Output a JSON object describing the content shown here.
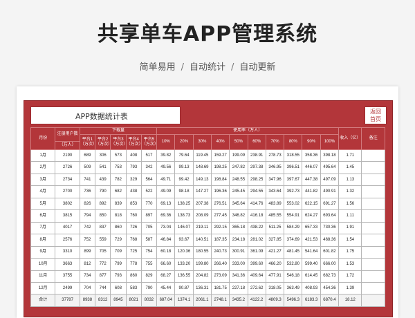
{
  "title": "共享单车APP管理系统",
  "subtitle": [
    "简单易用",
    "自动统计",
    "自动更新"
  ],
  "separator": "/",
  "panel": {
    "heading": "APP数据统计表",
    "return_label": [
      "返回",
      "首页"
    ]
  },
  "table": {
    "headers": {
      "month": "月份",
      "users": "注册用户数",
      "users_unit": "（万人）",
      "downloads": "下载量",
      "platforms": [
        "平台1（万次）",
        "平台2（万次）",
        "平台3（万次）",
        "平台4（万次）",
        "平台5（万次）"
      ],
      "usage": "使用率（万人）",
      "usage_levels": [
        "10%",
        "20%",
        "30%",
        "40%",
        "50%",
        "60%",
        "70%",
        "80%",
        "90%",
        "100%"
      ],
      "income": "收入（亿）",
      "note": "备注"
    },
    "rows": [
      [
        "1月",
        "2190",
        "689",
        "306",
        "573",
        "408",
        "517",
        "39.82",
        "79.64",
        "119.45",
        "159.27",
        "199.09",
        "238.91",
        "278.73",
        "318.55",
        "358.36",
        "398.18",
        "1.71",
        ""
      ],
      [
        "2月",
        "2726",
        "509",
        "541",
        "753",
        "793",
        "342",
        "49.56",
        "99.13",
        "148.69",
        "198.25",
        "247.82",
        "297.38",
        "346.95",
        "396.51",
        "446.07",
        "495.64",
        "1.45",
        ""
      ],
      [
        "3月",
        "2734",
        "741",
        "439",
        "782",
        "329",
        "564",
        "49.71",
        "99.42",
        "149.13",
        "198.84",
        "248.55",
        "298.25",
        "347.96",
        "397.67",
        "447.38",
        "497.09",
        "1.13",
        ""
      ],
      [
        "4月",
        "2700",
        "736",
        "790",
        "682",
        "438",
        "522",
        "49.09",
        "98.18",
        "147.27",
        "196.36",
        "245.45",
        "294.55",
        "343.64",
        "392.73",
        "441.82",
        "490.91",
        "1.32",
        ""
      ],
      [
        "5月",
        "3802",
        "826",
        "892",
        "839",
        "853",
        "770",
        "69.13",
        "138.25",
        "207.38",
        "276.51",
        "345.64",
        "414.76",
        "483.89",
        "553.02",
        "622.15",
        "691.27",
        "1.56",
        ""
      ],
      [
        "6月",
        "3815",
        "794",
        "850",
        "818",
        "760",
        "897",
        "69.36",
        "138.73",
        "208.09",
        "277.45",
        "346.82",
        "416.18",
        "485.55",
        "554.91",
        "624.27",
        "693.64",
        "1.11",
        ""
      ],
      [
        "7月",
        "4017",
        "742",
        "837",
        "860",
        "726",
        "705",
        "73.04",
        "146.07",
        "219.11",
        "292.15",
        "365.18",
        "438.22",
        "511.25",
        "584.29",
        "657.33",
        "730.36",
        "1.91",
        ""
      ],
      [
        "8月",
        "2576",
        "752",
        "559",
        "729",
        "768",
        "587",
        "46.84",
        "93.67",
        "140.51",
        "187.35",
        "234.18",
        "281.02",
        "327.85",
        "374.69",
        "421.53",
        "468.36",
        "1.54",
        ""
      ],
      [
        "9月",
        "3310",
        "899",
        "705",
        "709",
        "725",
        "754",
        "60.18",
        "120.36",
        "180.55",
        "240.73",
        "300.91",
        "361.09",
        "421.27",
        "481.45",
        "541.64",
        "601.82",
        "1.75",
        ""
      ],
      [
        "10月",
        "3663",
        "812",
        "772",
        "799",
        "778",
        "755",
        "66.60",
        "133.20",
        "199.80",
        "266.40",
        "333.00",
        "399.60",
        "466.20",
        "532.80",
        "599.40",
        "666.00",
        "1.53",
        ""
      ],
      [
        "11月",
        "3755",
        "734",
        "877",
        "793",
        "860",
        "829",
        "68.27",
        "136.55",
        "204.82",
        "273.09",
        "341.36",
        "409.64",
        "477.91",
        "546.18",
        "614.45",
        "682.73",
        "1.72",
        ""
      ],
      [
        "12月",
        "2499",
        "704",
        "744",
        "608",
        "583",
        "790",
        "45.44",
        "90.87",
        "136.31",
        "181.75",
        "227.18",
        "272.62",
        "318.05",
        "363.49",
        "408.93",
        "454.36",
        "1.39",
        ""
      ],
      [
        "合计",
        "37787",
        "8938",
        "8312",
        "8945",
        "8021",
        "8032",
        "687.04",
        "1374.1",
        "2061.1",
        "2748.1",
        "3435.2",
        "4122.2",
        "4809.3",
        "5496.3",
        "6183.3",
        "6870.4",
        "18.12",
        ""
      ]
    ]
  }
}
